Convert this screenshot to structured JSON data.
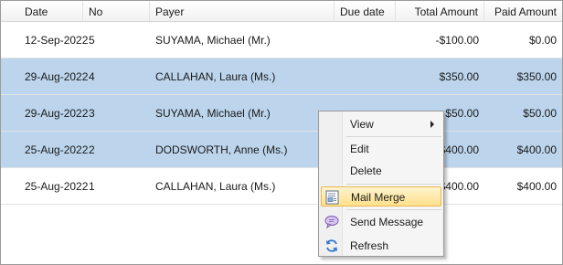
{
  "columns": [
    {
      "key": "date",
      "label": "Date"
    },
    {
      "key": "no",
      "label": "No"
    },
    {
      "key": "payer",
      "label": "Payer"
    },
    {
      "key": "due_date",
      "label": "Due date"
    },
    {
      "key": "total_amount",
      "label": "Total Amount"
    },
    {
      "key": "paid_amount",
      "label": "Paid Amount"
    }
  ],
  "rows": [
    {
      "date": "12-Sep-2022",
      "no": "5",
      "payer": "SUYAMA, Michael (Mr.)",
      "due_date": "",
      "total_amount": "-$100.00",
      "paid_amount": "$0.00",
      "selected": false
    },
    {
      "date": "29-Aug-2022",
      "no": "4",
      "payer": "CALLAHAN, Laura (Ms.)",
      "due_date": "",
      "total_amount": "$350.00",
      "paid_amount": "$350.00",
      "selected": true
    },
    {
      "date": "29-Aug-2022",
      "no": "3",
      "payer": "SUYAMA, Michael (Mr.)",
      "due_date": "",
      "total_amount": "$50.00",
      "paid_amount": "$50.00",
      "selected": true
    },
    {
      "date": "25-Aug-2022",
      "no": "2",
      "payer": "DODSWORTH, Anne (Ms.)",
      "due_date": "",
      "total_amount": "$400.00",
      "paid_amount": "$400.00",
      "selected": true
    },
    {
      "date": "25-Aug-2022",
      "no": "1",
      "payer": "CALLAHAN, Laura (Ms.)",
      "due_date": "",
      "total_amount": "$400.00",
      "paid_amount": "$400.00",
      "selected": false
    }
  ],
  "context_menu": {
    "items": [
      {
        "label": "View",
        "icon": "",
        "has_submenu": true,
        "highlighted": false
      },
      {
        "label": "Edit",
        "icon": "",
        "has_submenu": false,
        "highlighted": false
      },
      {
        "label": "Delete",
        "icon": "",
        "has_submenu": false,
        "highlighted": false
      },
      {
        "label": "Mail Merge",
        "icon": "mail-merge-icon",
        "has_submenu": false,
        "highlighted": true
      },
      {
        "label": "Send Message",
        "icon": "message-icon",
        "has_submenu": false,
        "highlighted": false
      },
      {
        "label": "Refresh",
        "icon": "refresh-icon",
        "has_submenu": false,
        "highlighted": false
      }
    ]
  },
  "colors": {
    "selection": "#bcd5ec",
    "menu_highlight": "#ffe08a"
  }
}
